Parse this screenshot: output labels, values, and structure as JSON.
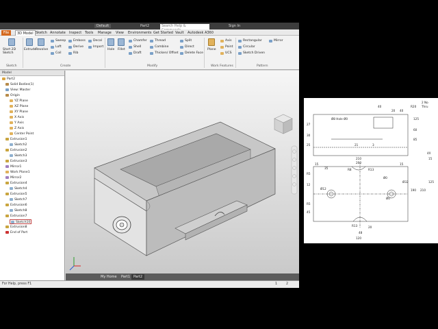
{
  "titlebar": {
    "workspace": "Default",
    "doc_name": "Part2",
    "search_placeholder": "Search Help & Commands...",
    "sign_in": "Sign In"
  },
  "tabs": [
    "File",
    "3D Model",
    "Sketch",
    "Annotate",
    "Inspect",
    "Tools",
    "Manage",
    "View",
    "Environments",
    "Get Started",
    "Vault",
    "Autodesk A360"
  ],
  "ribbon": {
    "start_sketch": "Start 2D Sketch",
    "sketch_group": "Sketch",
    "create_group": "Create",
    "extrude": "Extrude",
    "revolve": "Revolve",
    "sweep": "Sweep",
    "loft": "Loft",
    "coil": "Coil",
    "emboss": "Emboss",
    "derive": "Derive",
    "rib": "Rib",
    "decal": "Decal",
    "import": "Import",
    "hole": "Hole",
    "fillet": "Fillet",
    "chamfer": "Chamfer",
    "shell": "Shell",
    "draft": "Draft",
    "thread": "Thread",
    "combine": "Combine",
    "thicken": "Thicken/ Offset",
    "split": "Split",
    "direct": "Direct",
    "delete_face": "Delete Face",
    "modify_group": "Modify",
    "plane": "Plane",
    "axis": "Axis",
    "point": "Point",
    "ucs": "UCS",
    "work_features_group": "Work Features",
    "rectangular": "Rectangular",
    "circular": "Circular",
    "sketch_driven": "Sketch Driven",
    "mirror": "Mirror",
    "pattern_group": "Pattern"
  },
  "browser": {
    "header": "Model",
    "items": [
      "Part2",
      "Solid Bodies(1)",
      "View: Master",
      "Origin",
      "YZ Plane",
      "XZ Plane",
      "XY Plane",
      "X Axis",
      "Y Axis",
      "Z Axis",
      "Center Point",
      "Extrusion1",
      "Sketch2",
      "Extrusion2",
      "Sketch3",
      "Extrusion3",
      "Mirror1",
      "Work Plane1",
      "Mirror2",
      "Extrusion4",
      "Sketch4",
      "Extrusion5",
      "Sketch7",
      "Extrusion6",
      "Sketch8",
      "Extrusion7",
      "Sketch10",
      "Extrusion8",
      "End of Part"
    ]
  },
  "doc_tabs": [
    "My Home",
    "Part1",
    "Part2"
  ],
  "status": {
    "help": "For Help, press F1",
    "count1": "1",
    "count2": "2"
  },
  "drawing": {
    "dims": [
      "40",
      "R20",
      "2 No",
      "Thru",
      "20",
      "40",
      "27",
      "30",
      "25",
      "125",
      "60",
      "85",
      "21",
      "3",
      "210",
      "15",
      "200",
      "15",
      "35",
      "R8",
      "R13",
      "R5",
      "12",
      "R5",
      "45",
      "190",
      "210",
      "R13",
      "20",
      "48",
      "120",
      "125",
      "4X",
      "15",
      "Ø8 Hole Ø0",
      "Ø0",
      "Ø0",
      "Ø32",
      "Ø12"
    ]
  },
  "colors": {
    "file_tab": "#d4691f",
    "viewport_top": "#f6f6f6",
    "model_face": "#b9b9b9"
  }
}
